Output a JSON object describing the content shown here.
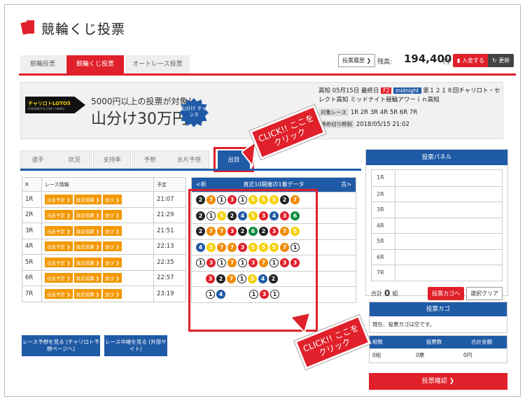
{
  "app": {
    "title": "競輪くじ投票"
  },
  "tabs": [
    {
      "label": "競輪投票"
    },
    {
      "label": "競輪くじ投票"
    },
    {
      "label": "オートレース投票"
    }
  ],
  "header": {
    "history_label": "投票履歴 ❯",
    "balance_label": "残高:",
    "balance_value": "194,400",
    "balance_unit": "円",
    "deposit_label": "入金する",
    "refresh_label": "更新"
  },
  "banner": {
    "logo_text": "チャリロトLOTO5",
    "logo_sub": "CHARIROTO.COM / 5WINS",
    "promo_line": "5000円以上の投票が対象！",
    "promo_big": "山分け30万円",
    "badge": "山分け チャンス"
  },
  "race": {
    "venue_date": "高知 05月15日 最終日",
    "grade": "F2",
    "tag": "midnight",
    "title": "第１２１８回チャリロト・セレクト高知 ミッドナイト競輪アワーｉｎ高知",
    "target_label": "対象レース",
    "target_races": "1R 2R 3R 4R 5R 6R 7R",
    "deadline_label": "締め切り時刻",
    "deadline": "2018/05/15 21:02"
  },
  "subtabs": [
    {
      "label": "選手"
    },
    {
      "label": "状況"
    },
    {
      "label": "支持率"
    },
    {
      "label": "予想"
    },
    {
      "label": "氷片予想"
    },
    {
      "label": "出目"
    }
  ],
  "table": {
    "headers": [
      "R",
      "レース情報",
      "予定"
    ],
    "buttons": [
      "出走予定 ❯",
      "直近成績 ❯",
      "並び ❯"
    ],
    "rows": [
      {
        "r": "1R",
        "time": "21:07"
      },
      {
        "r": "2R",
        "time": "21:29"
      },
      {
        "r": "3R",
        "time": "21:51"
      },
      {
        "r": "4R",
        "time": "22:13"
      },
      {
        "r": "5R",
        "time": "22:35"
      },
      {
        "r": "6R",
        "time": "22:57"
      },
      {
        "r": "7R",
        "time": "23:19"
      }
    ]
  },
  "results": {
    "new_label": "<新",
    "title": "直近10開催の1着データ",
    "old_label": "古>",
    "rows": [
      {
        "balls": [
          "2",
          "7",
          "1",
          "3",
          "1",
          "5",
          "5",
          "5",
          "2",
          "7"
        ]
      },
      {
        "balls": [
          "2",
          "1",
          "5",
          "2",
          "4",
          "5",
          "3",
          "4",
          "3",
          "6"
        ]
      },
      {
        "balls": [
          "2",
          "7",
          "7",
          "3",
          "2",
          "6",
          "2",
          "3",
          "7",
          "5"
        ]
      },
      {
        "balls": [
          "4",
          "5",
          "7",
          "7",
          "3",
          "5",
          "5",
          "5",
          "7",
          "1"
        ]
      },
      {
        "balls": [
          "1",
          "3",
          "1",
          "7",
          "1",
          "3",
          "7",
          "1",
          "3",
          "3"
        ]
      },
      {
        "balls": [
          "3",
          "2",
          "7",
          "1",
          "5",
          "4",
          "2"
        ]
      },
      {
        "balls": [
          "1",
          "4",
          "",
          "",
          "1",
          "3",
          "1"
        ]
      }
    ]
  },
  "links": {
    "forecast": "レース予想を見る (チャリロト予想ページへ)",
    "live": "レース中継を見る (外部サイト)"
  },
  "panel": {
    "title": "投票パネル",
    "rows": [
      "1R",
      "2R",
      "3R",
      "4R",
      "5R",
      "6R",
      "7R"
    ],
    "total_label": "合計",
    "total_value": "0",
    "total_unit": "組",
    "to_cart": "投票カゴへ",
    "clear": "選択クリア"
  },
  "cart": {
    "title": "投票カゴ",
    "empty": "現在、投票カゴは空です。",
    "cols": [
      "組数",
      "投票数",
      "合計金額"
    ],
    "vals": [
      "0組",
      "0票",
      "0円"
    ],
    "confirm": "投票確認 ❯"
  },
  "callouts": {
    "text1": "CLICK!! ここをクリック",
    "text2": "CLICK!! ここをクリック"
  },
  "colors": {
    "accent_red": "#e0202a",
    "accent_blue": "#1f5aa6",
    "button_orange": "#f39800"
  }
}
